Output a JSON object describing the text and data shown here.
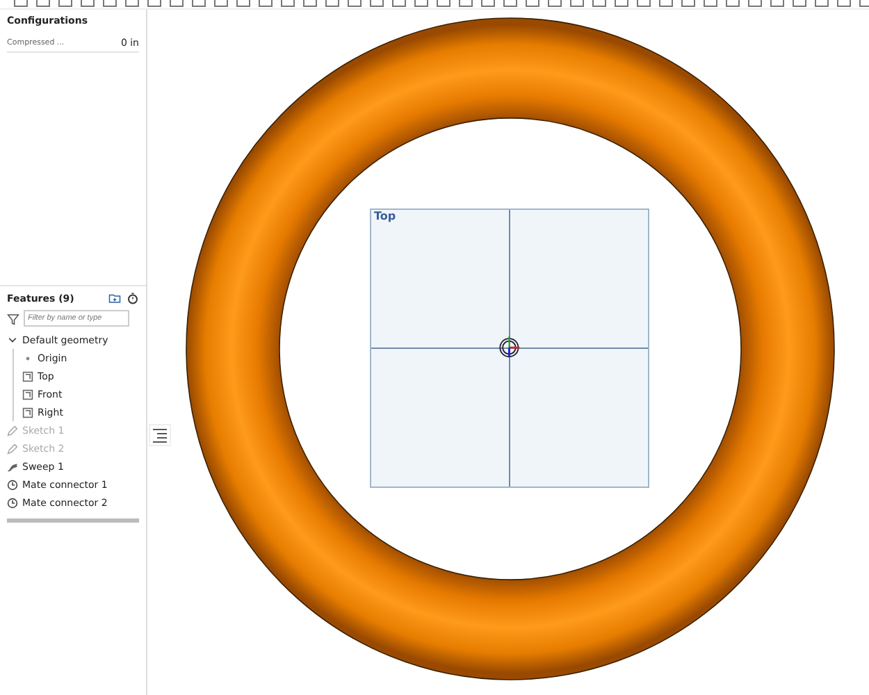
{
  "configurations": {
    "title": "Configurations",
    "rows": [
      {
        "label": "Compressed ...",
        "value": "0 in"
      }
    ]
  },
  "features": {
    "title": "Features (9)",
    "filter": {
      "placeholder": "Filter by name or type"
    },
    "items": [
      {
        "kind": "group",
        "label": "Default geometry",
        "expanded": true,
        "children": [
          {
            "kind": "origin",
            "label": "Origin",
            "hidden": false
          },
          {
            "kind": "plane",
            "label": "Top",
            "hidden": false
          },
          {
            "kind": "plane",
            "label": "Front",
            "hidden": false
          },
          {
            "kind": "plane",
            "label": "Right",
            "hidden": false
          }
        ]
      },
      {
        "kind": "sketch",
        "label": "Sketch 1",
        "hidden": true
      },
      {
        "kind": "sketch",
        "label": "Sketch 2",
        "hidden": true
      },
      {
        "kind": "sweep",
        "label": "Sweep 1",
        "hidden": false
      },
      {
        "kind": "mate",
        "label": "Mate connector 1",
        "hidden": false
      },
      {
        "kind": "mate",
        "label": "Mate connector 2",
        "hidden": false
      }
    ]
  },
  "viewport": {
    "plane_label": "Top"
  }
}
